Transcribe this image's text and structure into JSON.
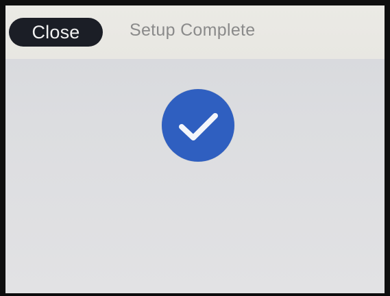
{
  "header": {
    "close_label": "Close",
    "title": "Setup Complete"
  },
  "status": {
    "icon": "checkmark-icon",
    "color": "#2f5fc0"
  }
}
